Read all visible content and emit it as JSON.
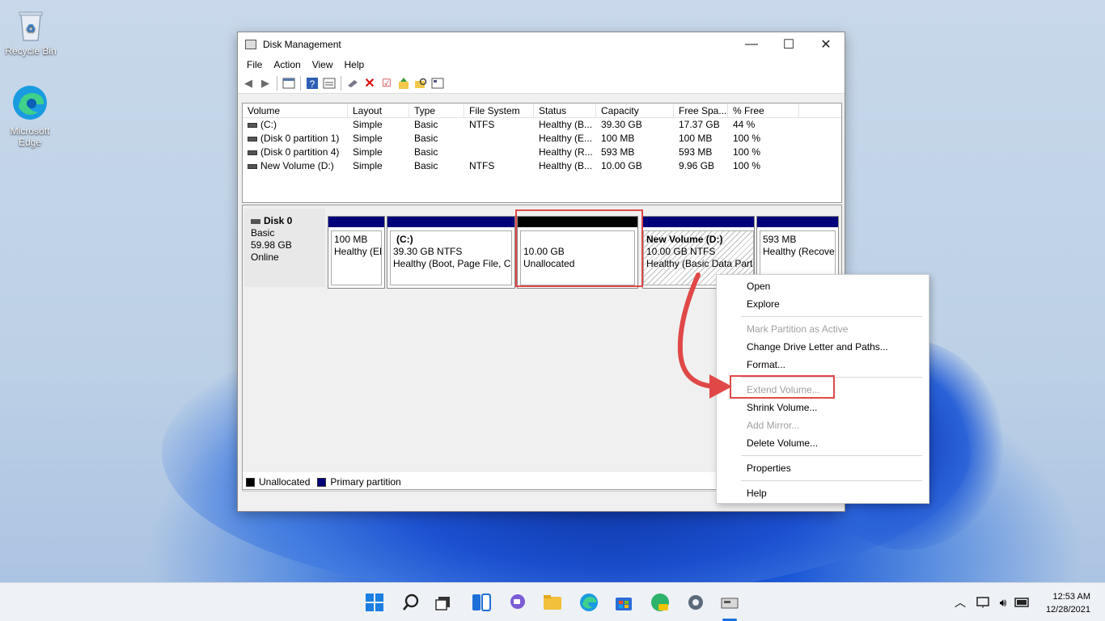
{
  "desktop": {
    "icons": [
      {
        "label": "Recycle Bin"
      },
      {
        "label": "Microsoft Edge"
      }
    ]
  },
  "window": {
    "title": "Disk Management",
    "controls": {
      "minimize": "—",
      "maximize": "☐",
      "close": "✕"
    },
    "menu": [
      "File",
      "Action",
      "View",
      "Help"
    ]
  },
  "volume_list": {
    "columns": [
      "Volume",
      "Layout",
      "Type",
      "File System",
      "Status",
      "Capacity",
      "Free Spa...",
      "% Free"
    ],
    "rows": [
      [
        "(C:)",
        "Simple",
        "Basic",
        "NTFS",
        "Healthy (B...",
        "39.30 GB",
        "17.37 GB",
        "44 %"
      ],
      [
        "(Disk 0 partition 1)",
        "Simple",
        "Basic",
        "",
        "Healthy (E...",
        "100 MB",
        "100 MB",
        "100 %"
      ],
      [
        "(Disk 0 partition 4)",
        "Simple",
        "Basic",
        "",
        "Healthy (R...",
        "593 MB",
        "593 MB",
        "100 %"
      ],
      [
        "New Volume (D:)",
        "Simple",
        "Basic",
        "NTFS",
        "Healthy (B...",
        "10.00 GB",
        "9.96 GB",
        "100 %"
      ]
    ]
  },
  "disk": {
    "name": "Disk 0",
    "type": "Basic",
    "size": "59.98 GB",
    "state": "Online",
    "partitions": [
      {
        "title": "",
        "size": "100 MB",
        "status": "Healthy (EF"
      },
      {
        "title": "(C:)",
        "size": "39.30 GB NTFS",
        "status": "Healthy (Boot, Page File, Cra"
      },
      {
        "title": "",
        "size": "10.00 GB",
        "status": "Unallocated"
      },
      {
        "title": "New Volume  (D:)",
        "size": "10.00 GB NTFS",
        "status": "Healthy (Basic Data Parti"
      },
      {
        "title": "",
        "size": "593 MB",
        "status": "Healthy (Recove"
      }
    ]
  },
  "legend": {
    "unallocated": "Unallocated",
    "primary": "Primary partition"
  },
  "context_menu": {
    "items": [
      {
        "label": "Open",
        "enabled": true
      },
      {
        "label": "Explore",
        "enabled": true
      },
      {
        "label": "Mark Partition as Active",
        "enabled": false
      },
      {
        "label": "Change Drive Letter and Paths...",
        "enabled": true
      },
      {
        "label": "Format...",
        "enabled": true
      },
      {
        "label": "Extend Volume...",
        "enabled": false
      },
      {
        "label": "Shrink Volume...",
        "enabled": true
      },
      {
        "label": "Add Mirror...",
        "enabled": false
      },
      {
        "label": "Delete Volume...",
        "enabled": true
      },
      {
        "label": "Properties",
        "enabled": true
      },
      {
        "label": "Help",
        "enabled": true
      }
    ]
  },
  "taskbar": {
    "time": "12:53 AM",
    "date": "12/28/2021",
    "apps": [
      "start-icon",
      "search-icon",
      "task-view-icon",
      "widgets-icon",
      "chat-icon",
      "file-explorer-icon",
      "edge-icon",
      "store-icon",
      "edge-canary-icon",
      "settings-icon",
      "disk-management-icon"
    ]
  },
  "colors": {
    "primary_partition": "#00007a",
    "unallocated": "#000000",
    "highlight": "#e04848"
  }
}
